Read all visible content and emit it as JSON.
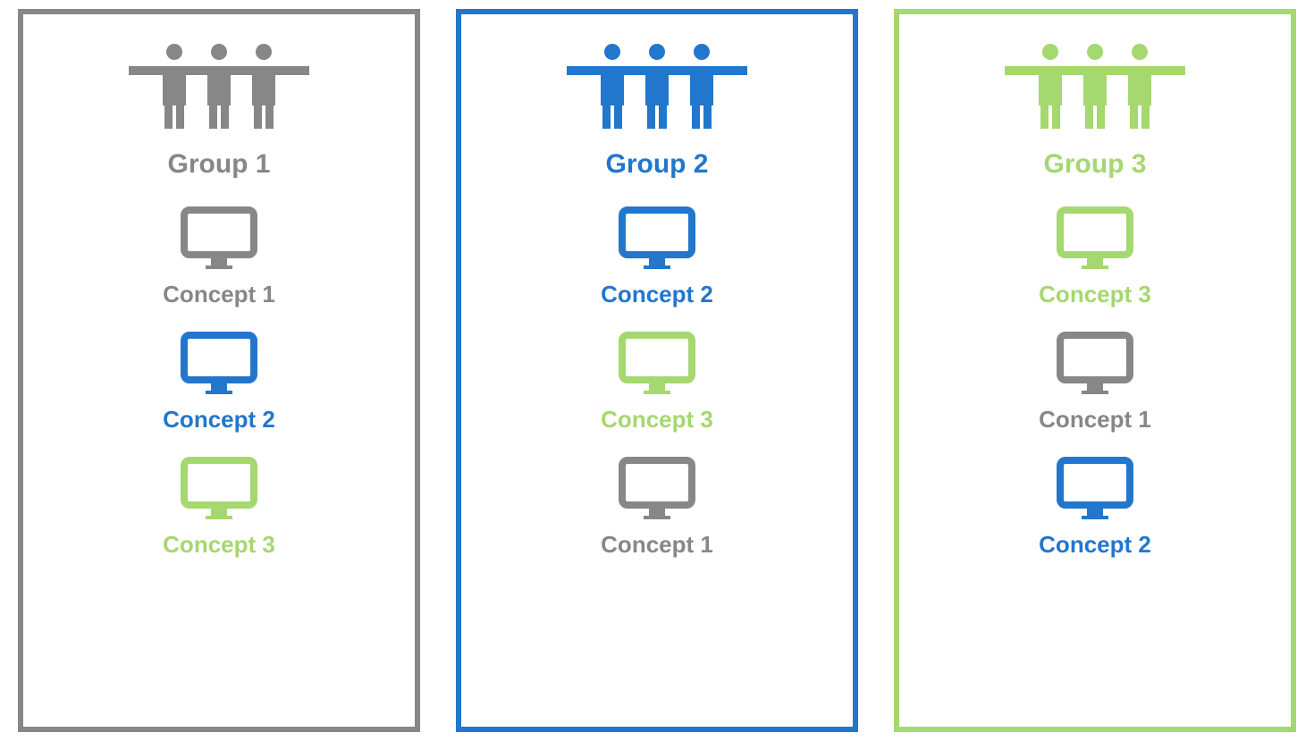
{
  "colors": {
    "gray": "#878787",
    "blue": "#2277cc",
    "green": "#a5d86f"
  },
  "panels": [
    {
      "color": "gray",
      "group_title": "Group 1",
      "concepts": [
        {
          "label": "Concept 1",
          "color": "gray"
        },
        {
          "label": "Concept 2",
          "color": "blue"
        },
        {
          "label": "Concept 3",
          "color": "green"
        }
      ]
    },
    {
      "color": "blue",
      "group_title": "Group 2",
      "concepts": [
        {
          "label": "Concept 2",
          "color": "blue"
        },
        {
          "label": "Concept 3",
          "color": "green"
        },
        {
          "label": "Concept 1",
          "color": "gray"
        }
      ]
    },
    {
      "color": "green",
      "group_title": "Group 3",
      "concepts": [
        {
          "label": "Concept 3",
          "color": "green"
        },
        {
          "label": "Concept 1",
          "color": "gray"
        },
        {
          "label": "Concept 2",
          "color": "blue"
        }
      ]
    }
  ]
}
